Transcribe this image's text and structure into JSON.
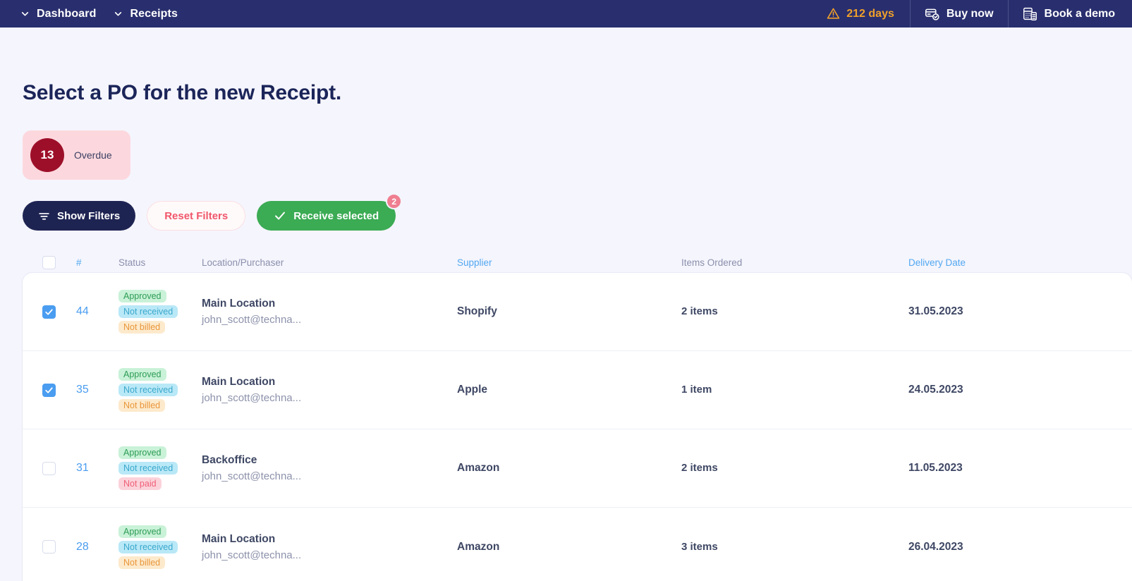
{
  "topbar": {
    "breadcrumb": [
      {
        "label": "Dashboard",
        "icon": "chevron-down-icon"
      },
      {
        "label": "Receipts",
        "icon": "chevron-down-icon"
      }
    ],
    "trial": {
      "label": "212 days",
      "icon": "warning-triangle-icon",
      "color": "#f0a02a"
    },
    "buy_now": {
      "label": "Buy now",
      "icon": "credit-card-check-icon"
    },
    "book_demo": {
      "label": "Book a demo",
      "icon": "calculator-device-icon"
    }
  },
  "page": {
    "title": "Select a PO for the new Receipt."
  },
  "stats": {
    "overdue": {
      "count": "13",
      "label": "Overdue",
      "circle_color": "#9d0f29",
      "pill_color": "#fcd8de"
    }
  },
  "toolbar": {
    "show_filters": {
      "label": "Show Filters",
      "icon": "filter-icon"
    },
    "reset_filters": {
      "label": "Reset Filters"
    },
    "receive_selected": {
      "label": "Receive selected",
      "icon": "check-icon",
      "badge": "2"
    }
  },
  "table": {
    "columns": {
      "number": "#",
      "status": "Status",
      "location": "Location/Purchaser",
      "supplier": "Supplier",
      "items": "Items Ordered",
      "delivery": "Delivery Date"
    },
    "sortable_columns": [
      "number",
      "supplier",
      "delivery"
    ],
    "select_all_checked": false,
    "rows": [
      {
        "checked": true,
        "number": "44",
        "badges": [
          {
            "text": "Approved",
            "style": "approved"
          },
          {
            "text": "Not received",
            "style": "not-received"
          },
          {
            "text": "Not billed",
            "style": "not-billed"
          }
        ],
        "location": "Main Location",
        "purchaser": "john_scott@techna...",
        "supplier": "Shopify",
        "items": "2 items",
        "delivery": "31.05.2023"
      },
      {
        "checked": true,
        "number": "35",
        "badges": [
          {
            "text": "Approved",
            "style": "approved"
          },
          {
            "text": "Not received",
            "style": "not-received"
          },
          {
            "text": "Not billed",
            "style": "not-billed"
          }
        ],
        "location": "Main Location",
        "purchaser": "john_scott@techna...",
        "supplier": "Apple",
        "items": "1 item",
        "delivery": "24.05.2023"
      },
      {
        "checked": false,
        "number": "31",
        "badges": [
          {
            "text": "Approved",
            "style": "approved"
          },
          {
            "text": "Not received",
            "style": "not-received"
          },
          {
            "text": "Not paid",
            "style": "not-paid"
          }
        ],
        "location": "Backoffice",
        "purchaser": "john_scott@techna...",
        "supplier": "Amazon",
        "items": "2 items",
        "delivery": "11.05.2023"
      },
      {
        "checked": false,
        "number": "28",
        "badges": [
          {
            "text": "Approved",
            "style": "approved"
          },
          {
            "text": "Not received",
            "style": "not-received"
          },
          {
            "text": "Not billed",
            "style": "not-billed"
          }
        ],
        "location": "Main Location",
        "purchaser": "john_scott@techna...",
        "supplier": "Amazon",
        "items": "3 items",
        "delivery": "26.04.2023"
      }
    ]
  }
}
